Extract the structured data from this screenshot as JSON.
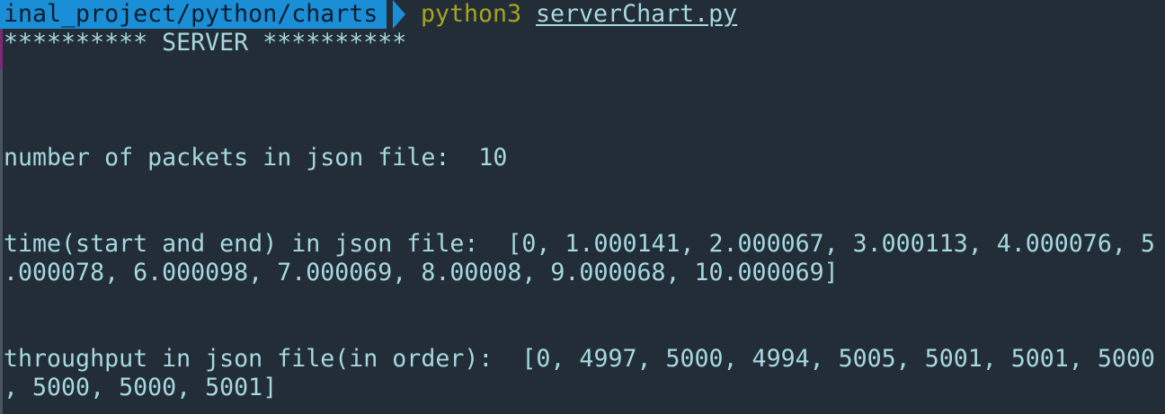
{
  "prompt": {
    "path": "inal_project/python/charts",
    "command": "python3",
    "argument": "serverChart.py"
  },
  "output": {
    "banner": "********** SERVER **********",
    "packets_line": "number of packets in json file:  10",
    "time_line_1": "time(start and end) in json file:  [0, 1.000141, 2.000067, 3.000113, 4.000076, 5",
    "time_line_2": ".000078, 6.000098, 7.000069, 8.00008, 9.000068, 10.000069]",
    "throughput_line_1": "throughput in json file(in order):  [0, 4997, 5000, 4994, 5005, 5001, 5001, 5000",
    "throughput_line_2": ", 5000, 5000, 5001]"
  },
  "colors": {
    "background": "#222d37",
    "text": "#a6d8df",
    "prompt_path_bg": "#1a8fd8",
    "command": "#a7a41f"
  }
}
